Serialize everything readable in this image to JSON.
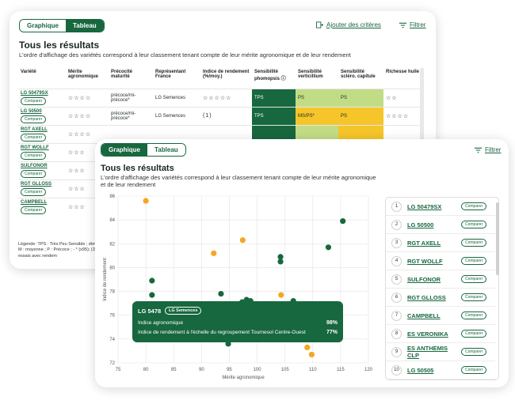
{
  "back": {
    "tabs": [
      "Graphique",
      "Tableau"
    ],
    "add_criteria": "Ajouter des critères",
    "filter": "Filtrer",
    "title": "Tous les résultats",
    "description": "L'ordre d'affichage des variétés correspond à leur classement tenant compte de leur mérite agronomique et de leur rendement",
    "columns": [
      "Variété",
      "Mérite agronomique",
      "Précocité maturité",
      "Représentant France",
      "Indice de rendement (%/moy.)",
      "Sensibilité phomopsis ⓘ",
      "Sensibilité verticillium",
      "Sensibilité scléro. capitule",
      "Richesse huile"
    ],
    "rows": [
      {
        "name": "LG 50479SX",
        "merit": "☆☆☆☆",
        "prec": "précoce/mi-précoce*",
        "rep": "LG Semences",
        "yield": "☆☆☆☆☆",
        "phomo": "TPS",
        "verti": "PS",
        "sclero": "PS",
        "huile": "☆☆"
      },
      {
        "name": "LG 50500",
        "merit": "☆☆☆☆",
        "prec": "précoce/mi-précoce*",
        "rep": "LG Semences",
        "yield": "(1)",
        "phomo": "TPS",
        "verti": "MS/PS*",
        "sclero": "PS",
        "huile": "☆☆☆☆"
      },
      {
        "name": "RGT AXELL",
        "merit": "☆☆☆☆",
        "prec": "",
        "rep": "",
        "yield": "",
        "phomo": "",
        "verti": "",
        "sclero": "",
        "huile": ""
      },
      {
        "name": "RGT WOLLF",
        "merit": "☆☆☆",
        "prec": "",
        "rep": "",
        "yield": "",
        "phomo": "",
        "verti": "",
        "sclero": "",
        "huile": ""
      },
      {
        "name": "SULFONOR",
        "merit": "☆☆☆",
        "prec": "",
        "rep": "",
        "yield": "",
        "phomo": "",
        "verti": "",
        "sclero": "",
        "huile": ""
      },
      {
        "name": "RGT GLLOSS",
        "merit": "☆☆☆",
        "prec": "",
        "rep": "",
        "yield": "",
        "phomo": "",
        "verti": "",
        "sclero": "",
        "huile": ""
      },
      {
        "name": "CAMPBELL",
        "merit": "☆☆☆",
        "prec": "",
        "rep": "",
        "yield": "",
        "phomo": "",
        "verti": "",
        "sclero": "",
        "huile": ""
      }
    ],
    "compare": "Comparer",
    "legend": "Légende :TPS : Très Peu Sensible ; élevée ; M : moyenne ; P : Précoce ; - * (x95); (3) % essais avec rendem"
  },
  "front": {
    "tabs": [
      "Graphique",
      "Tableau"
    ],
    "filter": "Filtrer",
    "title": "Tous les résultats",
    "description": "L'ordre d'affichage des variétés correspond à leur classement tenant compte de leur mérite agronomique et de leur rendement",
    "tooltip": {
      "name": "LG 5478",
      "badge": "LG Semences",
      "row1_label": "Indice agronomique",
      "row1_value": "98%",
      "row2_label": "Indice de rendement à l'échelle du regroupement Tournesol Centre-Ouest",
      "row2_value": "77%"
    },
    "ranking": [
      {
        "rank": "1",
        "name": "LG 50479SX"
      },
      {
        "rank": "2",
        "name": "LG 50500"
      },
      {
        "rank": "3",
        "name": "RGT AXELL"
      },
      {
        "rank": "4",
        "name": "RGT WOLLF"
      },
      {
        "rank": "5",
        "name": "SULFONOR"
      },
      {
        "rank": "6",
        "name": "RGT GLLOSS"
      },
      {
        "rank": "7",
        "name": "CAMPBELL"
      },
      {
        "rank": "8",
        "name": "ES VERONIKA"
      },
      {
        "rank": "9",
        "name": "ES ANTHEMIS CLP"
      },
      {
        "rank": "10",
        "name": "LG 50505"
      }
    ],
    "compare": "Comparer"
  },
  "colors": {
    "green": "#17673f",
    "orange": "#f5a623",
    "grid": "#e3e3e3"
  },
  "chart_data": {
    "type": "scatter",
    "xlabel": "Mérite agronomique",
    "ylabel": "Indice de rendement",
    "xlim": [
      75,
      120
    ],
    "ylim": [
      72,
      86
    ],
    "xticks": [
      75,
      80,
      85,
      90,
      95,
      100,
      105,
      110,
      115,
      120
    ],
    "yticks": [
      72,
      74,
      76,
      78,
      80,
      82,
      84,
      86
    ],
    "grid": true,
    "series": [
      {
        "color": "green",
        "points": [
          [
            115.4,
            83.9
          ],
          [
            112.8,
            81.7
          ],
          [
            104.2,
            80.9
          ],
          [
            104.2,
            80.5
          ],
          [
            81.1,
            78.9
          ],
          [
            81.1,
            77.7
          ],
          [
            93.5,
            77.8
          ],
          [
            98.1,
            77.3
          ],
          [
            98.8,
            77.2
          ],
          [
            97.3,
            77.1
          ],
          [
            106.5,
            77.2
          ],
          [
            94.8,
            73.6
          ]
        ]
      },
      {
        "color": "orange",
        "points": [
          [
            80.0,
            85.6
          ],
          [
            97.4,
            82.3
          ],
          [
            92.2,
            81.2
          ],
          [
            104.3,
            77.7
          ],
          [
            109.0,
            73.3
          ],
          [
            109.8,
            72.7
          ]
        ]
      }
    ]
  }
}
